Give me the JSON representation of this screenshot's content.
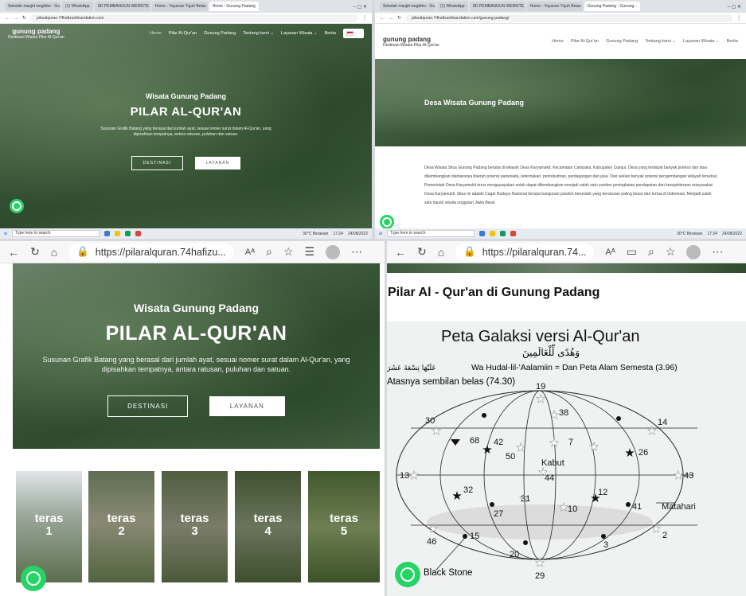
{
  "panel_a": {
    "tabs": [
      "Sekolah masjid wegbibo - Go...",
      "(1) WhatsApp",
      "SD PEMBANGUN WEBSITE",
      "Home - Yayasan Tujuh Belas",
      "Home - Gunung Padang"
    ],
    "url": "pilaralquran.74hafizuinfoundation.com",
    "brand_title": "gunung padang",
    "brand_sub": "Destinasi Wisata Pilar Al-Qur'an",
    "nav": [
      "Home",
      "Pilar Al-Qur'an",
      "Gunung Padang",
      "Tentang kami ⌄",
      "Layanan Wisata ⌄",
      "Berita"
    ],
    "hero_kicker": "Wisata Gunung Padang",
    "hero_title": "PILAR AL-QUR'AN",
    "hero_desc": "Susunan Grafik Batang yang berasal dari jumlah ayat, sesuai nomer surat dalam Al-Qur'an, yang dipisahkan tempatnya, antara ratusan, puluhan dan satuan.",
    "btn_destinasi": "DESTINASI",
    "btn_layanan": "LAYANAN",
    "taskbar_search": "Type here to search",
    "taskbar_weather": "30°C Berawan",
    "taskbar_time": "17:24",
    "taskbar_date": "24/08/2022"
  },
  "panel_b": {
    "tabs": [
      "Sekolah masjid wegbibo - Go...",
      "(1) WhatsApp",
      "SD PEMBANGUN WEBSITE",
      "Home - Yayasan Tujuh Belas",
      "Gunung Padang - Gunung..."
    ],
    "url": "pilaralquran.74hafizuinfoundation.com/gunung-padang/",
    "brand_title": "gunung padang",
    "brand_sub": "Destinasi Wisata Pilar Al-Qur'an",
    "nav": [
      "Home",
      "Pilar Al-Qur'an",
      "Gunung Padang",
      "Tentang kami ⌄",
      "Layanan Wisata ⌄",
      "Berita"
    ],
    "banner_title": "Desa Wisata Gunung Padang",
    "body_text": "Desa Wisata Situs Gunung Padang berada di wilayah Desa Karyamukti, Kecamatan Campaka, Kabupaten Cianjur. Desa yang terdapat banyak potensi dan bisa dikembangkan diantaranya daerah potensi pariwisata, peternakan, perindustrian, perdagangan dan jasa. Dari sekian banyak potensi pengembangan wilayah tersebut, Pemerintah Desa Karyamukti terus mengupayakan untuk dapat dikembangkan menjadi salah satu sumber peningkatan pendapatan dan kesejahteraan masyarakat Desa Karyamukti. Situs ini adalah Cagar Budaya Nasional berupa bangunan punden berundak yang berukuran paling besar dan tertua di Indonesia. Menjadi salah satu tujuan wisata unggulan Jawa Barat",
    "taskbar_search": "Type here to search",
    "taskbar_weather": "30°C Berawan",
    "taskbar_time": "17:24",
    "taskbar_date": "24/08/2022"
  },
  "panel_c": {
    "url": "https://pilaralquran.74hafizu...",
    "hero_kicker": "Wisata Gunung Padang",
    "hero_title": "PILAR AL-QUR'AN",
    "hero_desc": "Susunan Grafik Batang yang berasal dari jumlah ayat, sesuai nomer surat dalam Al-Qur'an, yang dipisahkan tempatnya, antara ratusan, puluhan dan satuan.",
    "btn_destinasi": "DESTINASI",
    "btn_layanan": "LAYANAN",
    "teras": [
      {
        "word": "teras",
        "num": "1"
      },
      {
        "word": "teras",
        "num": "2"
      },
      {
        "word": "teras",
        "num": "3"
      },
      {
        "word": "teras",
        "num": "4"
      },
      {
        "word": "teras",
        "num": "5"
      }
    ]
  },
  "panel_d": {
    "url": "https://pilaralquran.74...",
    "heading": "Pilar Al - Qur'an di Gunung Padang",
    "map_title": "Peta Galaksi versi Al-Qur'an",
    "arabic_top": "وَهُدًى لِّلْعَالَمِينَ",
    "subtitle": "Wa Hudal-lil-'Aalamiin = Dan Peta Alam Semesta (3.96)",
    "arabic_left": "عَلَيْهَا تِسْعَةَ عَشَرَ",
    "caption_left": "Atasnya sembilan belas (74.30)",
    "labels": {
      "n19": "19",
      "n38": "38",
      "n30": "30",
      "n14": "14",
      "n68": "68",
      "n42": "42",
      "n7": "7",
      "n50": "50",
      "n26": "26",
      "kabut": "Kabut",
      "n44": "44",
      "n13": "13",
      "n43": "43",
      "n32": "32",
      "n12": "12",
      "n31": "31",
      "n41": "41",
      "matahari": "Matahari",
      "n27": "27",
      "n10": "10",
      "n46": "46",
      "n15": "15",
      "n3": "3",
      "n2": "2",
      "n20": "20",
      "n29": "29"
    },
    "black_stone": "Black Stone"
  }
}
